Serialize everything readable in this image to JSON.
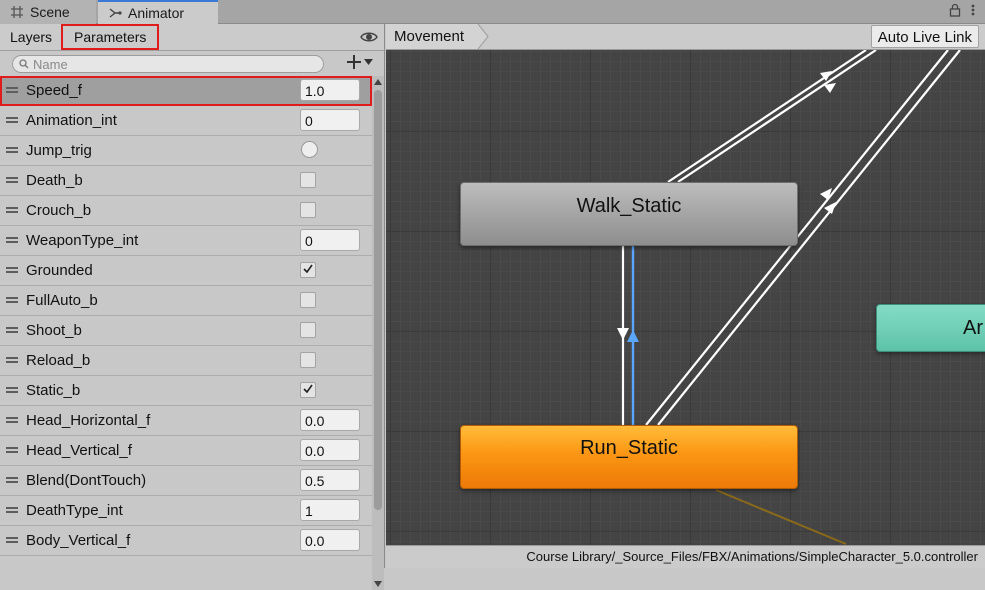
{
  "window": {
    "tabs": [
      {
        "label": "Scene",
        "icon": "grid-icon"
      },
      {
        "label": "Animator",
        "icon": "animator-icon"
      }
    ]
  },
  "left_panel": {
    "subtabs": {
      "layers": "Layers",
      "parameters": "Parameters"
    },
    "search": {
      "placeholder": "Name"
    },
    "parameters": [
      {
        "name": "Speed_f",
        "type": "float",
        "value": "1.0",
        "selected": true
      },
      {
        "name": "Animation_int",
        "type": "int",
        "value": "0"
      },
      {
        "name": "Jump_trig",
        "type": "trigger",
        "checked": false
      },
      {
        "name": "Death_b",
        "type": "bool",
        "checked": false
      },
      {
        "name": "Crouch_b",
        "type": "bool",
        "checked": false
      },
      {
        "name": "WeaponType_int",
        "type": "int",
        "value": "0"
      },
      {
        "name": "Grounded",
        "type": "bool",
        "checked": true
      },
      {
        "name": "FullAuto_b",
        "type": "bool",
        "checked": false
      },
      {
        "name": "Shoot_b",
        "type": "bool",
        "checked": false
      },
      {
        "name": "Reload_b",
        "type": "bool",
        "checked": false
      },
      {
        "name": "Static_b",
        "type": "bool",
        "checked": true
      },
      {
        "name": "Head_Horizontal_f",
        "type": "float",
        "value": "0.0"
      },
      {
        "name": "Head_Vertical_f",
        "type": "float",
        "value": "0.0"
      },
      {
        "name": "Blend(DontTouch)",
        "type": "float",
        "value": "0.5"
      },
      {
        "name": "DeathType_int",
        "type": "int",
        "value": "1"
      },
      {
        "name": "Body_Vertical_f",
        "type": "float",
        "value": "0.0"
      }
    ]
  },
  "graph": {
    "breadcrumb": "Movement",
    "auto_live_link": "Auto Live Link",
    "states": {
      "walk": "Walk_Static",
      "run": "Run_Static",
      "partial": "Ar"
    },
    "file_path": "Course Library/_Source_Files/FBX/Animations/SimpleCharacter_5.0.controller"
  },
  "colors": {
    "tab_accent": "#3a79d6",
    "highlight": "#e01b1b",
    "run_state": "#fb9613",
    "walk_state": "#a0a0a0",
    "teal_state": "#6ccfb4",
    "selected_transition": "#5aa6ff"
  }
}
